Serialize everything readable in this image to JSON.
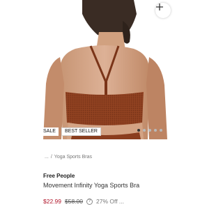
{
  "hero": {
    "badges": {
      "sale": "SALE",
      "best_seller": "BEST SELLER"
    },
    "carousel": {
      "count": 5,
      "active_index": 0
    }
  },
  "breadcrumb": {
    "ellipsis": "...",
    "separator": "/",
    "current": "Yoga Sports Bras"
  },
  "product": {
    "brand": "Free People",
    "title": "Movement Infinity Yoga Sports Bra",
    "price_sale": "$22.99",
    "price_original": "$58.00",
    "info_icon": "?",
    "discount": "27% Off ..."
  },
  "colors": {
    "sale_price": "#b0152a",
    "garment": "#8a3d1e"
  }
}
